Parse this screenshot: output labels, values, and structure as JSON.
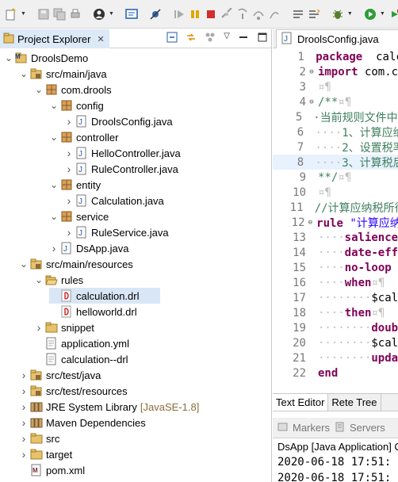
{
  "explorer": {
    "tab_label": "Project Explorer",
    "tree": [
      {
        "label": "DroolsDemo",
        "icon": "maven-project-icon",
        "depth": 0,
        "chev": "down"
      },
      {
        "label": "src/main/java",
        "icon": "source-folder-icon",
        "depth": 1,
        "chev": "down"
      },
      {
        "label": "com.drools",
        "icon": "package-icon",
        "depth": 2,
        "chev": "down"
      },
      {
        "label": "config",
        "icon": "package-icon",
        "depth": 3,
        "chev": "down"
      },
      {
        "label": "DroolsConfig.java",
        "icon": "java-file-icon",
        "depth": 4,
        "chev": "right"
      },
      {
        "label": "controller",
        "icon": "package-icon",
        "depth": 3,
        "chev": "down"
      },
      {
        "label": "HelloController.java",
        "icon": "java-file-icon",
        "depth": 4,
        "chev": "right"
      },
      {
        "label": "RuleController.java",
        "icon": "java-file-icon",
        "depth": 4,
        "chev": "right"
      },
      {
        "label": "entity",
        "icon": "package-icon",
        "depth": 3,
        "chev": "down"
      },
      {
        "label": "Calculation.java",
        "icon": "java-file-icon",
        "depth": 4,
        "chev": "right"
      },
      {
        "label": "service",
        "icon": "package-icon",
        "depth": 3,
        "chev": "down"
      },
      {
        "label": "RuleService.java",
        "icon": "java-file-icon",
        "depth": 4,
        "chev": "right"
      },
      {
        "label": "DsApp.java",
        "icon": "java-file-icon",
        "depth": 3,
        "chev": "right"
      },
      {
        "label": "src/main/resources",
        "icon": "source-folder-icon",
        "depth": 1,
        "chev": "down"
      },
      {
        "label": "rules",
        "icon": "folder-open-icon",
        "depth": 2,
        "chev": "down"
      },
      {
        "label": "calculation.drl",
        "icon": "drools-file-icon",
        "depth": 3,
        "chev": "",
        "selected": true
      },
      {
        "label": "helloworld.drl",
        "icon": "drools-file-icon",
        "depth": 3,
        "chev": ""
      },
      {
        "label": "snippet",
        "icon": "folder-icon",
        "depth": 2,
        "chev": "right"
      },
      {
        "label": "application.yml",
        "icon": "text-file-icon",
        "depth": 2,
        "chev": ""
      },
      {
        "label": "calculation--drl",
        "icon": "text-file-icon",
        "depth": 2,
        "chev": ""
      },
      {
        "label": "src/test/java",
        "icon": "source-folder-icon",
        "depth": 1,
        "chev": "right"
      },
      {
        "label": "src/test/resources",
        "icon": "source-folder-icon",
        "depth": 1,
        "chev": "right"
      },
      {
        "label": "JRE System Library",
        "icon": "library-icon",
        "depth": 1,
        "chev": "right",
        "suffix": "[JavaSE-1.8]"
      },
      {
        "label": "Maven Dependencies",
        "icon": "library-icon",
        "depth": 1,
        "chev": "right"
      },
      {
        "label": "src",
        "icon": "folder-icon",
        "depth": 1,
        "chev": "right"
      },
      {
        "label": "target",
        "icon": "folder-icon",
        "depth": 1,
        "chev": "right"
      },
      {
        "label": "pom.xml",
        "icon": "xml-file-icon",
        "depth": 1,
        "chev": ""
      }
    ]
  },
  "editor": {
    "tab_label": "DroolsConfig.java",
    "lines": [
      {
        "n": "1",
        "parts": [
          [
            "kw",
            "package"
          ],
          [
            "",
            "  calc"
          ]
        ]
      },
      {
        "n": "2",
        "fold": "⊖",
        "parts": [
          [
            "kw",
            "import"
          ],
          [
            "",
            " com.c"
          ]
        ]
      },
      {
        "n": "3",
        "parts": [
          [
            "ws",
            "¤¶"
          ]
        ]
      },
      {
        "n": "4",
        "fold": "⊖",
        "parts": [
          [
            "cm",
            "/**"
          ],
          [
            "ws",
            "¤¶"
          ]
        ]
      },
      {
        "n": "5",
        "parts": [
          [
            "cm",
            "·当前规则文件中的"
          ]
        ]
      },
      {
        "n": "6",
        "parts": [
          [
            "ws",
            "····"
          ],
          [
            "cm",
            "1、计算应纳"
          ]
        ]
      },
      {
        "n": "7",
        "parts": [
          [
            "ws",
            "····"
          ],
          [
            "cm",
            "2、设置税率"
          ]
        ]
      },
      {
        "n": "8",
        "hl": true,
        "parts": [
          [
            "ws",
            "····"
          ],
          [
            "cm",
            "3、计算税后"
          ]
        ]
      },
      {
        "n": "9",
        "parts": [
          [
            "cm",
            "**/"
          ],
          [
            "ws",
            "¤¶"
          ]
        ]
      },
      {
        "n": "10",
        "parts": [
          [
            "ws",
            "¤¶"
          ]
        ]
      },
      {
        "n": "11",
        "parts": [
          [
            "cm",
            "//计算应纳税所得"
          ]
        ]
      },
      {
        "n": "12",
        "fold": "⊖",
        "parts": [
          [
            "kw",
            "rule"
          ],
          [
            "",
            " "
          ],
          [
            "str",
            "\"计算应纳"
          ]
        ]
      },
      {
        "n": "13",
        "parts": [
          [
            "ws",
            "····"
          ],
          [
            "kw",
            "salience"
          ]
        ]
      },
      {
        "n": "14",
        "parts": [
          [
            "ws",
            "····"
          ],
          [
            "kw",
            "date-eff"
          ]
        ]
      },
      {
        "n": "15",
        "parts": [
          [
            "ws",
            "····"
          ],
          [
            "kw",
            "no-loop"
          ]
        ]
      },
      {
        "n": "16",
        "parts": [
          [
            "ws",
            "····"
          ],
          [
            "kw",
            "when"
          ],
          [
            "ws",
            "¤¶"
          ]
        ]
      },
      {
        "n": "17",
        "parts": [
          [
            "ws",
            "········"
          ],
          [
            "",
            "$cal"
          ]
        ]
      },
      {
        "n": "18",
        "parts": [
          [
            "ws",
            "····"
          ],
          [
            "kw",
            "then"
          ],
          [
            "ws",
            "¤¶"
          ]
        ]
      },
      {
        "n": "19",
        "parts": [
          [
            "ws",
            "········"
          ],
          [
            "kw",
            "doub"
          ]
        ]
      },
      {
        "n": "20",
        "parts": [
          [
            "ws",
            "········"
          ],
          [
            "",
            "$cal"
          ]
        ]
      },
      {
        "n": "21",
        "parts": [
          [
            "ws",
            "········"
          ],
          [
            "kw",
            "upda"
          ]
        ]
      },
      {
        "n": "22",
        "parts": [
          [
            "kw",
            "end"
          ]
        ]
      }
    ],
    "bottom_tabs": [
      "Text Editor",
      "Rete Tree"
    ]
  },
  "console": {
    "tabs": [
      "Markers",
      "Servers"
    ],
    "title": "DsApp [Java Application] C",
    "lines": [
      "2020-06-18 17:51:",
      "2020-06-18 17:51:"
    ]
  }
}
